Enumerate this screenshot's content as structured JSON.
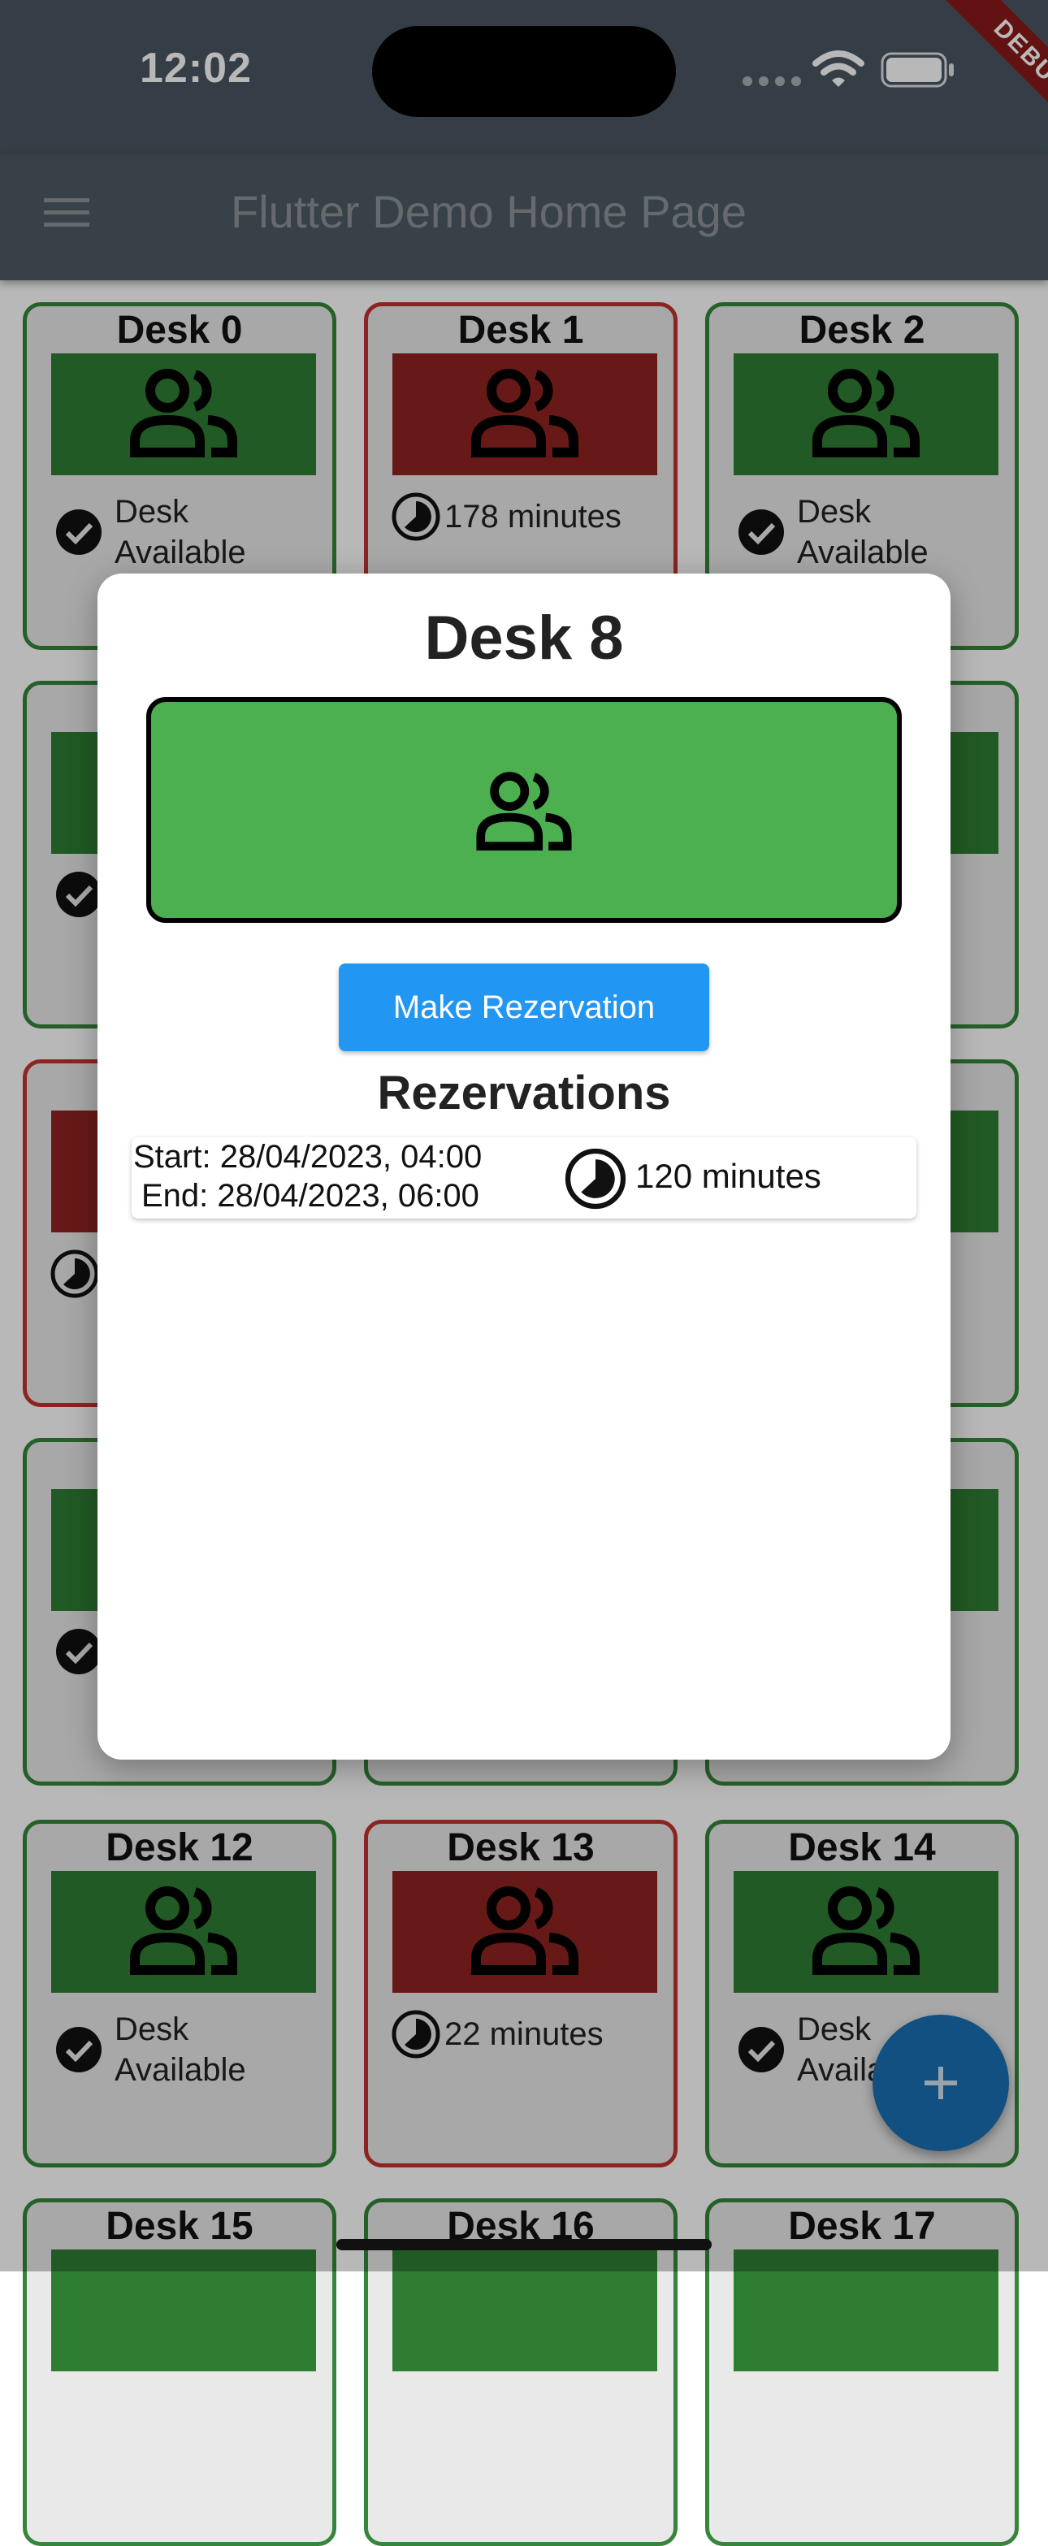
{
  "status_bar": {
    "time": "12:02",
    "debug_label": "DEBUG"
  },
  "app_bar": {
    "title": "Flutter Demo Home Page",
    "menu_icon": "menu-icon"
  },
  "desks": [
    {
      "name": "Desk 0",
      "state": "available",
      "status": "Desk Available"
    },
    {
      "name": "Desk 1",
      "state": "busy",
      "status": "178 minutes"
    },
    {
      "name": "Desk 2",
      "state": "available",
      "status": "Desk Available"
    },
    {
      "name": "Desk 12",
      "state": "available",
      "status": "Desk Available"
    },
    {
      "name": "Desk 13",
      "state": "busy",
      "status": "22 minutes"
    },
    {
      "name": "Desk 14",
      "state": "available",
      "status": "Desk Available"
    },
    {
      "name": "Desk 15",
      "state": "available",
      "status": ""
    },
    {
      "name": "Desk 16",
      "state": "available",
      "status": ""
    },
    {
      "name": "Desk 17",
      "state": "available",
      "status": ""
    }
  ],
  "dialog": {
    "title": "Desk 8",
    "button_label": "Make Rezervation",
    "reservations_title": "Rezervations",
    "reservations": [
      {
        "start": "Start: 28/04/2023, 04:00",
        "end": "End: 28/04/2023, 06:00",
        "duration": "120 minutes"
      }
    ]
  },
  "colors": {
    "available": "#2e7d32",
    "busy": "#8f2320",
    "dialog_desk": "#4caf50",
    "button": "#2196f3"
  },
  "icons": [
    "people-icon",
    "check-circle-icon",
    "timer-icon",
    "add-icon",
    "wifi-icon",
    "battery-icon"
  ]
}
